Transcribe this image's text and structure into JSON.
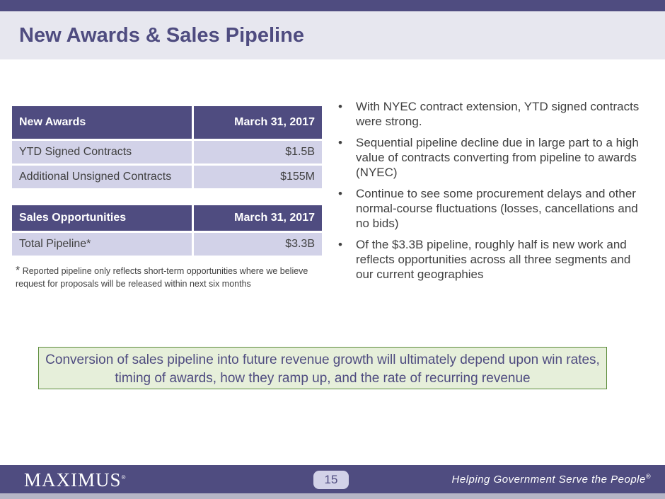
{
  "title": "New Awards & Sales Pipeline",
  "table_awards": {
    "header": [
      "New Awards",
      "March 31, 2017"
    ],
    "rows": [
      [
        "YTD Signed Contracts",
        "$1.5B"
      ],
      [
        "Additional Unsigned Contracts",
        "$155M"
      ]
    ]
  },
  "table_sales": {
    "header": [
      "Sales Opportunities",
      "March 31, 2017"
    ],
    "rows": [
      [
        "Total Pipeline*",
        "$3.3B"
      ]
    ]
  },
  "footnote_asterisk": "*",
  "footnote": " Reported pipeline only reflects short-term opportunities where we believe request for proposals will be released within next six months",
  "bullet_symbol": "•",
  "bullets": [
    "With NYEC contract extension, YTD signed contracts were strong.",
    "Sequential pipeline decline due in large part to a high value of contracts converting from pipeline to awards (NYEC)",
    "Continue to see some procurement delays and other normal-course fluctuations (losses, cancellations and no bids)",
    "Of the $3.3B pipeline, roughly half is new work and reflects opportunities across all three segments and our current geographies"
  ],
  "callout": "Conversion of sales pipeline into future revenue growth will ultimately depend upon win rates, timing of awards, how they ramp up, and the rate of recurring revenue",
  "footer": {
    "logo": "MAXIMUS",
    "logo_mark": "®",
    "page_number": "15",
    "tagline": "Helping Government Serve the People",
    "tagline_mark": "®"
  },
  "colors": {
    "brand_purple": "#4f4c80",
    "table_row": "#d2d2e8",
    "callout_bg": "#e6efda",
    "callout_border": "#5b8c3a"
  }
}
